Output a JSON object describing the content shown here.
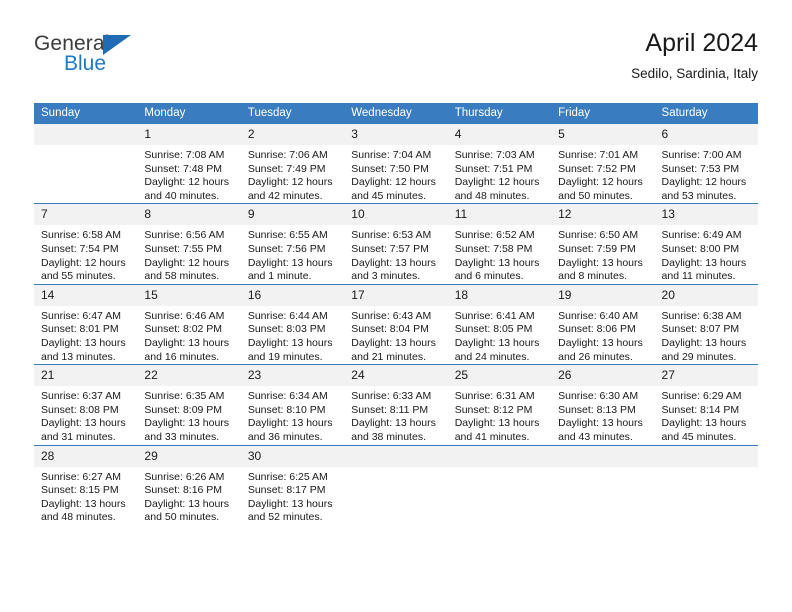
{
  "brand": {
    "name_top": "General",
    "name_bottom": "Blue",
    "accent_color": "#1f7ac4",
    "triangle_color": "#1f6cb4"
  },
  "header": {
    "title": "April 2024",
    "subtitle": "Sedilo, Sardinia, Italy"
  },
  "calendar": {
    "header_bg": "#3a7cc0",
    "header_text_color": "#ffffff",
    "daynum_bg": "#f2f2f2",
    "weekdays": [
      "Sunday",
      "Monday",
      "Tuesday",
      "Wednesday",
      "Thursday",
      "Friday",
      "Saturday"
    ],
    "weeks": [
      [
        {
          "day": "",
          "lines": [
            "",
            "",
            "",
            ""
          ]
        },
        {
          "day": "1",
          "lines": [
            "Sunrise: 7:08 AM",
            "Sunset: 7:48 PM",
            "Daylight: 12 hours",
            "and 40 minutes."
          ]
        },
        {
          "day": "2",
          "lines": [
            "Sunrise: 7:06 AM",
            "Sunset: 7:49 PM",
            "Daylight: 12 hours",
            "and 42 minutes."
          ]
        },
        {
          "day": "3",
          "lines": [
            "Sunrise: 7:04 AM",
            "Sunset: 7:50 PM",
            "Daylight: 12 hours",
            "and 45 minutes."
          ]
        },
        {
          "day": "4",
          "lines": [
            "Sunrise: 7:03 AM",
            "Sunset: 7:51 PM",
            "Daylight: 12 hours",
            "and 48 minutes."
          ]
        },
        {
          "day": "5",
          "lines": [
            "Sunrise: 7:01 AM",
            "Sunset: 7:52 PM",
            "Daylight: 12 hours",
            "and 50 minutes."
          ]
        },
        {
          "day": "6",
          "lines": [
            "Sunrise: 7:00 AM",
            "Sunset: 7:53 PM",
            "Daylight: 12 hours",
            "and 53 minutes."
          ]
        }
      ],
      [
        {
          "day": "7",
          "lines": [
            "Sunrise: 6:58 AM",
            "Sunset: 7:54 PM",
            "Daylight: 12 hours",
            "and 55 minutes."
          ]
        },
        {
          "day": "8",
          "lines": [
            "Sunrise: 6:56 AM",
            "Sunset: 7:55 PM",
            "Daylight: 12 hours",
            "and 58 minutes."
          ]
        },
        {
          "day": "9",
          "lines": [
            "Sunrise: 6:55 AM",
            "Sunset: 7:56 PM",
            "Daylight: 13 hours",
            "and 1 minute."
          ]
        },
        {
          "day": "10",
          "lines": [
            "Sunrise: 6:53 AM",
            "Sunset: 7:57 PM",
            "Daylight: 13 hours",
            "and 3 minutes."
          ]
        },
        {
          "day": "11",
          "lines": [
            "Sunrise: 6:52 AM",
            "Sunset: 7:58 PM",
            "Daylight: 13 hours",
            "and 6 minutes."
          ]
        },
        {
          "day": "12",
          "lines": [
            "Sunrise: 6:50 AM",
            "Sunset: 7:59 PM",
            "Daylight: 13 hours",
            "and 8 minutes."
          ]
        },
        {
          "day": "13",
          "lines": [
            "Sunrise: 6:49 AM",
            "Sunset: 8:00 PM",
            "Daylight: 13 hours",
            "and 11 minutes."
          ]
        }
      ],
      [
        {
          "day": "14",
          "lines": [
            "Sunrise: 6:47 AM",
            "Sunset: 8:01 PM",
            "Daylight: 13 hours",
            "and 13 minutes."
          ]
        },
        {
          "day": "15",
          "lines": [
            "Sunrise: 6:46 AM",
            "Sunset: 8:02 PM",
            "Daylight: 13 hours",
            "and 16 minutes."
          ]
        },
        {
          "day": "16",
          "lines": [
            "Sunrise: 6:44 AM",
            "Sunset: 8:03 PM",
            "Daylight: 13 hours",
            "and 19 minutes."
          ]
        },
        {
          "day": "17",
          "lines": [
            "Sunrise: 6:43 AM",
            "Sunset: 8:04 PM",
            "Daylight: 13 hours",
            "and 21 minutes."
          ]
        },
        {
          "day": "18",
          "lines": [
            "Sunrise: 6:41 AM",
            "Sunset: 8:05 PM",
            "Daylight: 13 hours",
            "and 24 minutes."
          ]
        },
        {
          "day": "19",
          "lines": [
            "Sunrise: 6:40 AM",
            "Sunset: 8:06 PM",
            "Daylight: 13 hours",
            "and 26 minutes."
          ]
        },
        {
          "day": "20",
          "lines": [
            "Sunrise: 6:38 AM",
            "Sunset: 8:07 PM",
            "Daylight: 13 hours",
            "and 29 minutes."
          ]
        }
      ],
      [
        {
          "day": "21",
          "lines": [
            "Sunrise: 6:37 AM",
            "Sunset: 8:08 PM",
            "Daylight: 13 hours",
            "and 31 minutes."
          ]
        },
        {
          "day": "22",
          "lines": [
            "Sunrise: 6:35 AM",
            "Sunset: 8:09 PM",
            "Daylight: 13 hours",
            "and 33 minutes."
          ]
        },
        {
          "day": "23",
          "lines": [
            "Sunrise: 6:34 AM",
            "Sunset: 8:10 PM",
            "Daylight: 13 hours",
            "and 36 minutes."
          ]
        },
        {
          "day": "24",
          "lines": [
            "Sunrise: 6:33 AM",
            "Sunset: 8:11 PM",
            "Daylight: 13 hours",
            "and 38 minutes."
          ]
        },
        {
          "day": "25",
          "lines": [
            "Sunrise: 6:31 AM",
            "Sunset: 8:12 PM",
            "Daylight: 13 hours",
            "and 41 minutes."
          ]
        },
        {
          "day": "26",
          "lines": [
            "Sunrise: 6:30 AM",
            "Sunset: 8:13 PM",
            "Daylight: 13 hours",
            "and 43 minutes."
          ]
        },
        {
          "day": "27",
          "lines": [
            "Sunrise: 6:29 AM",
            "Sunset: 8:14 PM",
            "Daylight: 13 hours",
            "and 45 minutes."
          ]
        }
      ],
      [
        {
          "day": "28",
          "lines": [
            "Sunrise: 6:27 AM",
            "Sunset: 8:15 PM",
            "Daylight: 13 hours",
            "and 48 minutes."
          ]
        },
        {
          "day": "29",
          "lines": [
            "Sunrise: 6:26 AM",
            "Sunset: 8:16 PM",
            "Daylight: 13 hours",
            "and 50 minutes."
          ]
        },
        {
          "day": "30",
          "lines": [
            "Sunrise: 6:25 AM",
            "Sunset: 8:17 PM",
            "Daylight: 13 hours",
            "and 52 minutes."
          ]
        },
        {
          "day": "",
          "lines": [
            "",
            "",
            "",
            ""
          ]
        },
        {
          "day": "",
          "lines": [
            "",
            "",
            "",
            ""
          ]
        },
        {
          "day": "",
          "lines": [
            "",
            "",
            "",
            ""
          ]
        },
        {
          "day": "",
          "lines": [
            "",
            "",
            "",
            ""
          ]
        }
      ]
    ]
  }
}
